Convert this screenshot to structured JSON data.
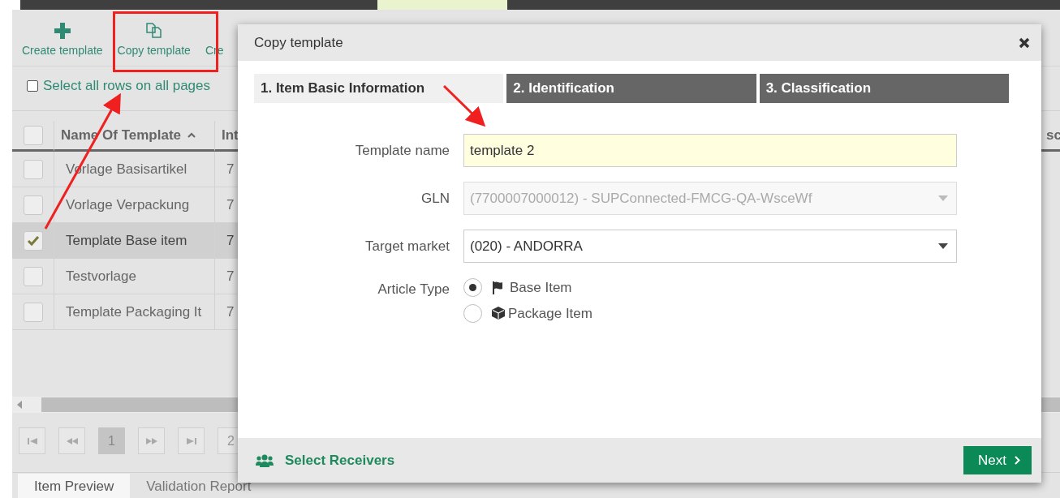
{
  "toolbar": [
    {
      "label": "Create template",
      "kind": "create"
    },
    {
      "label": "Copy template",
      "kind": "copy"
    },
    {
      "label": "Cre",
      "kind": "other"
    }
  ],
  "select_all": {
    "label": "Select all rows on all pages",
    "checked": false
  },
  "table": {
    "header_checked": false,
    "columns": [
      "Name Of Template",
      "Int",
      "sc"
    ],
    "rows": [
      {
        "cells": [
          "Vorlage Basisartikel",
          "7"
        ],
        "selected": false
      },
      {
        "cells": [
          "Vorlage Verpackung",
          "7"
        ],
        "selected": false
      },
      {
        "cells": [
          "Template Base item",
          "7"
        ],
        "selected": true
      },
      {
        "cells": [
          "Testvorlage",
          "7"
        ],
        "selected": false
      },
      {
        "cells": [
          "Template Packaging It",
          "7"
        ],
        "selected": false
      }
    ]
  },
  "pagination": {
    "pages": [
      {
        "label": "1",
        "selected": true
      },
      {
        "label": "2",
        "selected": false
      }
    ]
  },
  "bottom_tabs": [
    {
      "label": "Item Preview",
      "selected": true
    },
    {
      "label": "Validation Report",
      "selected": false
    }
  ],
  "dialog": {
    "title": "Copy template",
    "tabs": [
      {
        "label": "1. Item Basic Information",
        "selected": true
      },
      {
        "label": "2. Identification",
        "selected": false
      },
      {
        "label": "3. Classification",
        "selected": false
      }
    ],
    "fields": [
      {
        "label": "Template name",
        "value": "template 2",
        "kind": "text",
        "disabled": false
      },
      {
        "label": "GLN",
        "value": "(7700007000012) - SUPConnected-FMCG-QA-WsceWf",
        "kind": "select",
        "disabled": true
      },
      {
        "label": "Target market",
        "value": "(020) - ANDORRA",
        "kind": "select",
        "disabled": false
      }
    ],
    "article_type": {
      "label": "Article Type",
      "options": [
        {
          "label": "Base Item",
          "kind": "flag",
          "selected": true
        },
        {
          "label": "Package Item",
          "kind": "box",
          "selected": false
        }
      ]
    },
    "footer": {
      "link": "Select Receivers",
      "next": "Next"
    }
  }
}
